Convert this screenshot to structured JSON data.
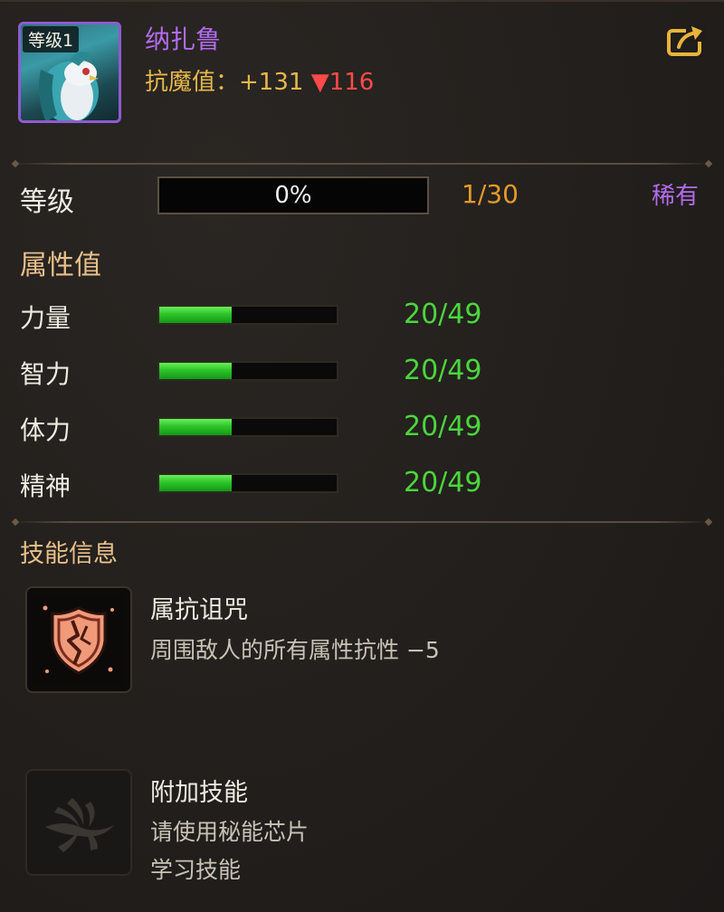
{
  "pet": {
    "level_tag": "等级1",
    "name": "纳扎鲁",
    "resist_label": "抗魔值：",
    "resist_value": "+131",
    "resist_delta": "▼116",
    "share_icon": "share-icon"
  },
  "level": {
    "label": "等级",
    "progress_text": "0%",
    "progress": 0,
    "count": "1/30",
    "rarity": "稀有"
  },
  "attributes": {
    "title": "属性值",
    "items": [
      {
        "label": "力量",
        "value": "20/49",
        "fill": 0.41
      },
      {
        "label": "智力",
        "value": "20/49",
        "fill": 0.41
      },
      {
        "label": "体力",
        "value": "20/49",
        "fill": 0.41
      },
      {
        "label": "精神",
        "value": "20/49",
        "fill": 0.41
      }
    ]
  },
  "skills": {
    "title": "技能信息",
    "items": [
      {
        "name": "属抗诅咒",
        "desc": "周围敌人的所有属性抗性 −5",
        "icon": "cracked-shield-icon"
      },
      {
        "name": "附加技能",
        "desc_line1": "请使用秘能芯片",
        "desc_line2": "学习技能",
        "icon": "locked-skill-icon"
      }
    ]
  },
  "colors": {
    "rarity": "#b36cf0",
    "gold": "#e6b84a",
    "green": "#4ad63c",
    "red": "#ff4a4a"
  }
}
